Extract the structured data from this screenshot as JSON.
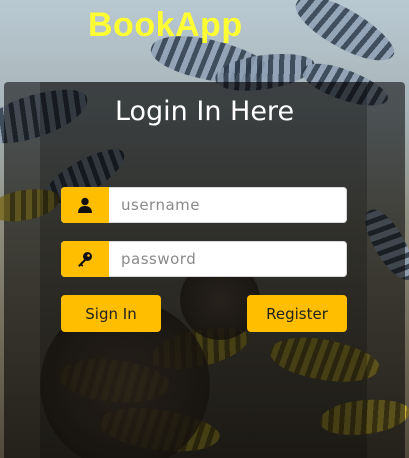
{
  "brand": {
    "name": "BookApp",
    "color": "#ffff33"
  },
  "login": {
    "title": "Login In Here",
    "username": {
      "placeholder": "username",
      "value": "",
      "icon": "user-icon"
    },
    "password": {
      "placeholder": "password",
      "value": "",
      "icon": "key-icon"
    },
    "signin_label": "Sign In",
    "register_label": "Register"
  },
  "colors": {
    "accent": "#ffbf00",
    "panel": "rgba(0,0,0,0.55)"
  }
}
